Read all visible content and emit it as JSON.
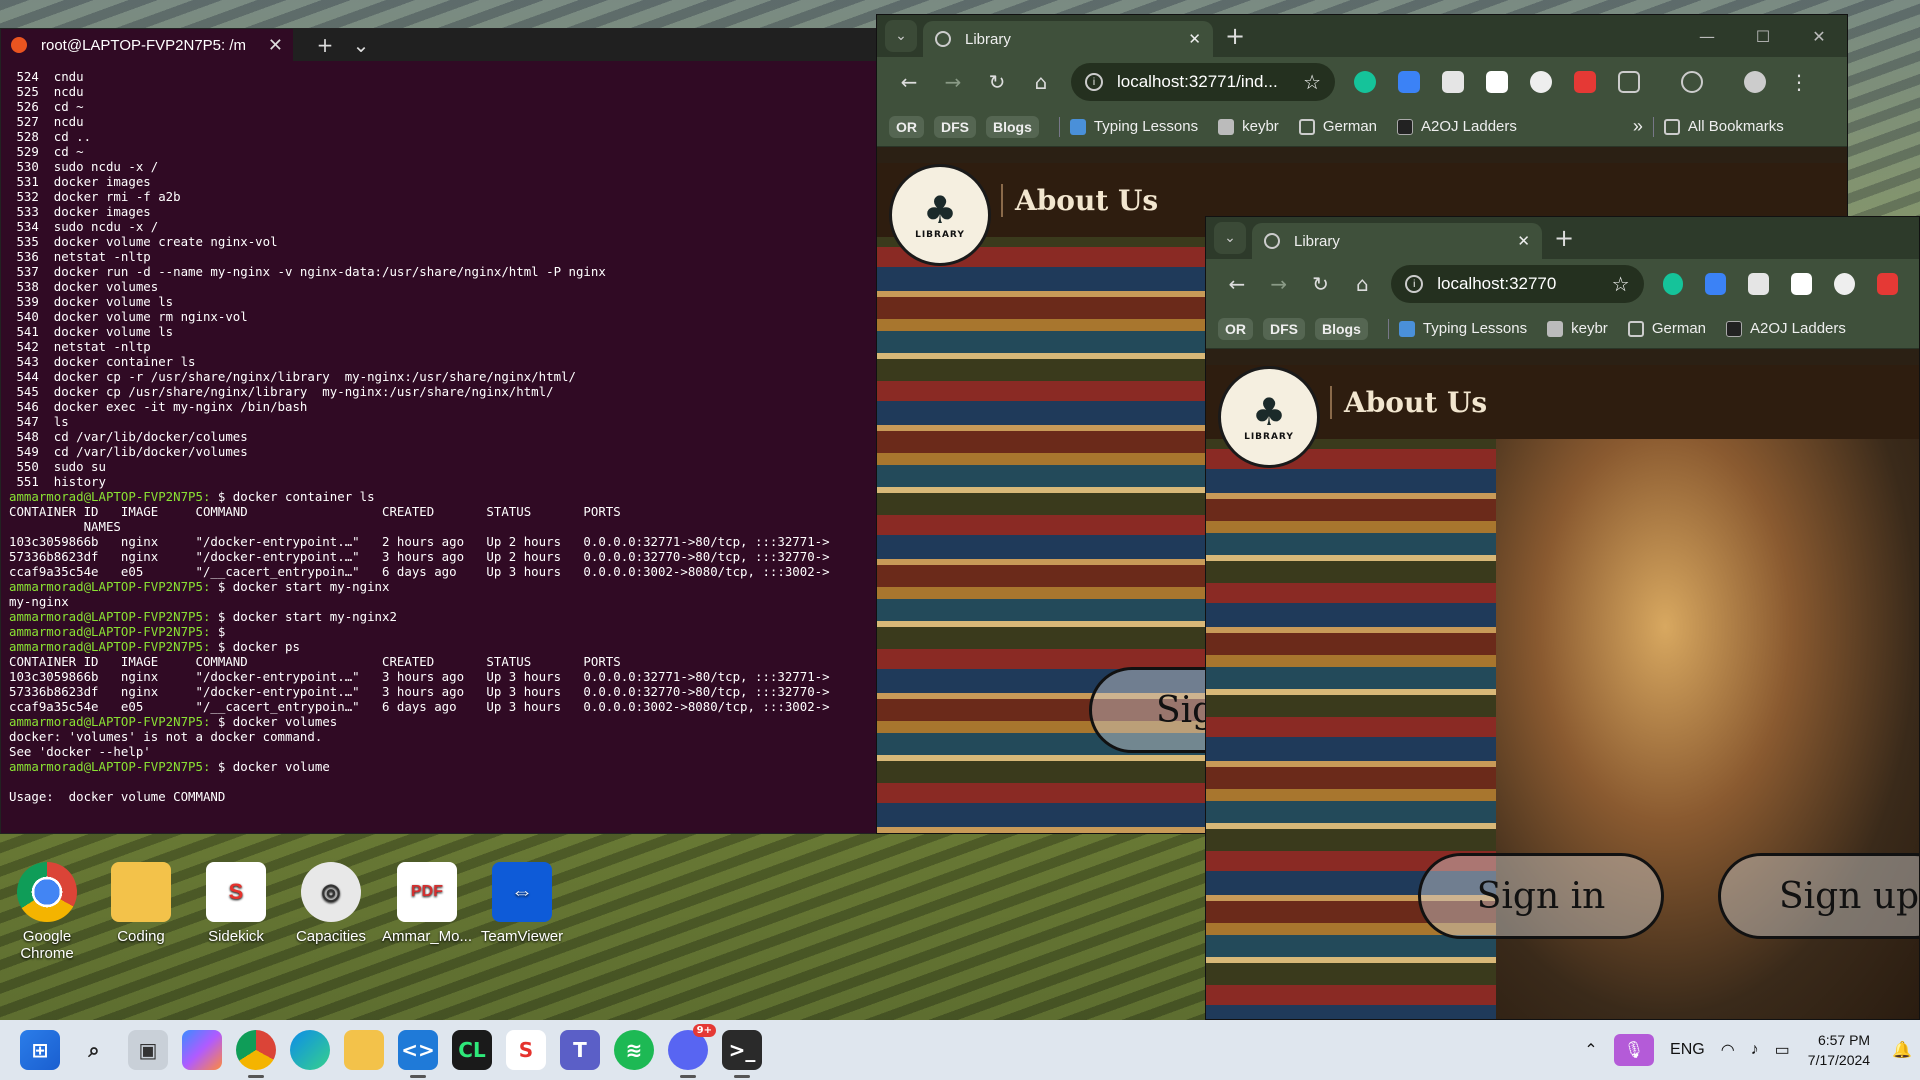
{
  "terminal": {
    "tab_title": "root@LAPTOP-FVP2N7P5: /m",
    "lines": [
      " 524  cndu",
      " 525  ncdu",
      " 526  cd ~",
      " 527  ncdu",
      " 528  cd ..",
      " 529  cd ~",
      " 530  sudo ncdu -x /",
      " 531  docker images",
      " 532  docker rmi -f a2b",
      " 533  docker images",
      " 534  sudo ncdu -x /",
      " 535  docker volume create nginx-vol",
      " 536  netstat -nltp",
      " 537  docker run -d --name my-nginx -v nginx-data:/usr/share/nginx/html -P nginx",
      " 538  docker volumes",
      " 539  docker volume ls",
      " 540  docker volume rm nginx-vol",
      " 541  docker volume ls",
      " 542  netstat -nltp",
      " 543  docker container ls",
      " 544  docker cp -r /usr/share/nginx/library  my-nginx:/usr/share/nginx/html/",
      " 545  docker cp /usr/share/nginx/library  my-nginx:/usr/share/nginx/html/",
      " 546  docker exec -it my-nginx /bin/bash",
      " 547  ls",
      " 548  cd /var/lib/docker/columes",
      " 549  cd /var/lib/docker/volumes",
      " 550  sudo su",
      " 551  history",
      "$ammarmorad@LAPTOP-FVP2N7P5:$ docker container ls",
      "CONTAINER ID   IMAGE     COMMAND                  CREATED       STATUS       PORTS",
      "          NAMES",
      "103c3059866b   nginx     \"/docker-entrypoint.…\"   2 hours ago   Up 2 hours   0.0.0.0:32771->80/tcp, :::32771->",
      "57336b8623df   nginx     \"/docker-entrypoint.…\"   3 hours ago   Up 2 hours   0.0.0.0:32770->80/tcp, :::32770->",
      "ccaf9a35c54e   e05       \"/__cacert_entrypoin…\"   6 days ago    Up 3 hours   0.0.0.0:3002->8080/tcp, :::3002->",
      "$ammarmorad@LAPTOP-FVP2N7P5:$ docker start my-nginx",
      "my-nginx",
      "$ammarmorad@LAPTOP-FVP2N7P5:$ docker start my-nginx2",
      "$ammarmorad@LAPTOP-FVP2N7P5:$ ",
      "$ammarmorad@LAPTOP-FVP2N7P5:$ docker ps",
      "CONTAINER ID   IMAGE     COMMAND                  CREATED       STATUS       PORTS",
      "103c3059866b   nginx     \"/docker-entrypoint.…\"   3 hours ago   Up 3 hours   0.0.0.0:32771->80/tcp, :::32771->",
      "57336b8623df   nginx     \"/docker-entrypoint.…\"   3 hours ago   Up 3 hours   0.0.0.0:32770->80/tcp, :::32770->",
      "ccaf9a35c54e   e05       \"/__cacert_entrypoin…\"   6 days ago    Up 3 hours   0.0.0.0:3002->8080/tcp, :::3002->",
      "$ammarmorad@LAPTOP-FVP2N7P5:$ docker volumes",
      "docker: 'volumes' is not a docker command.",
      "See 'docker --help'",
      "$ammarmorad@LAPTOP-FVP2N7P5:$ docker volume",
      "",
      "Usage:  docker volume COMMAND"
    ]
  },
  "desktop_icons": [
    {
      "label": "Google Chrome",
      "icon": "chrome-icon",
      "color": "#ffffff"
    },
    {
      "label": "Coding",
      "icon": "folder-icon",
      "color": "#f3c24a"
    },
    {
      "label": "Sidekick",
      "icon": "sidekick-icon",
      "color": "#ffffff"
    },
    {
      "label": "Capacities",
      "icon": "capacities-icon",
      "color": "#e8e8e8"
    },
    {
      "label": "Ammar_Mo...",
      "icon": "pdf-icon",
      "color": "#ffffff"
    },
    {
      "label": "TeamViewer",
      "icon": "teamviewer-icon",
      "color": "#0e5bd8"
    }
  ],
  "browser_back": {
    "tab_title": "Library",
    "url": "localhost:32771/ind...",
    "page_title": "About Us",
    "sign_partial": "Sig"
  },
  "browser_front": {
    "tab_title": "Library",
    "url": "localhost:32770",
    "page_title": "About Us",
    "sign_in": "Sign in",
    "sign_up": "Sign up"
  },
  "bookmarks": {
    "chips": [
      "OR",
      "DFS",
      "Blogs"
    ],
    "items": [
      "Typing Lessons",
      "keybr",
      "German",
      "A2OJ Ladders"
    ],
    "all_bookmarks": "All Bookmarks"
  },
  "logo_text": "LIBRARY",
  "taskbar": {
    "language": "ENG",
    "time": "6:57 PM",
    "date": "7/17/2024",
    "discord_badge": "9+"
  }
}
